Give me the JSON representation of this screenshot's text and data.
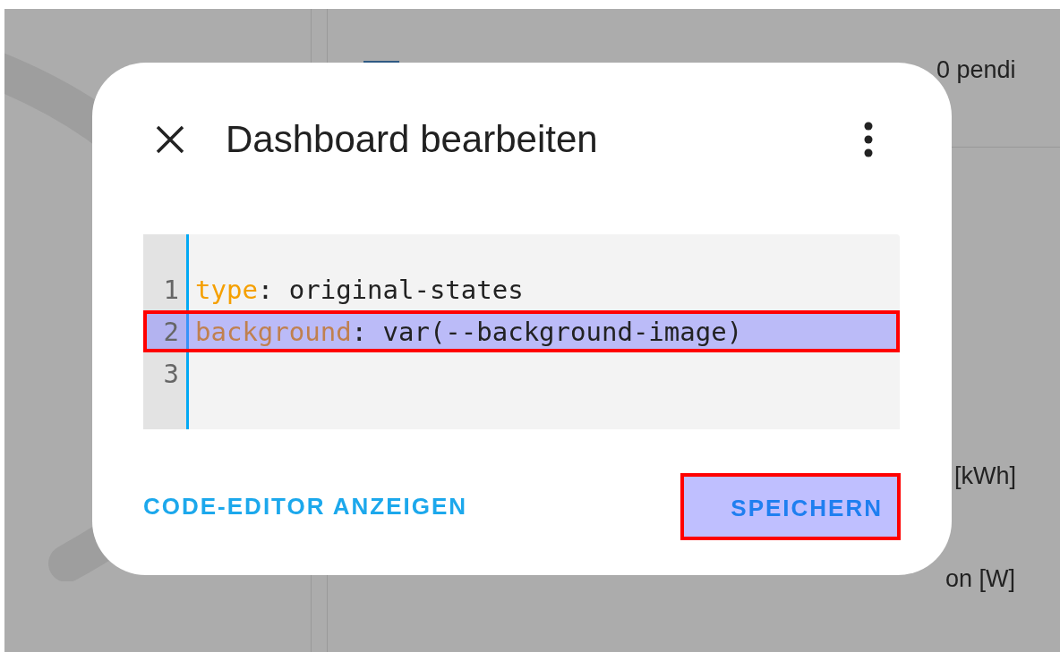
{
  "background": {
    "texts": [
      {
        "text": "0 pendi"
      },
      {
        "text": "[kWh]"
      },
      {
        "text": "on [W]"
      }
    ]
  },
  "dialog": {
    "title": "Dashboard bearbeiten",
    "editor": {
      "lines": [
        {
          "number": "1",
          "key": "type",
          "rest": ": original-states",
          "highlighted": false
        },
        {
          "number": "2",
          "key": "background",
          "rest": ": var(--background-image)",
          "highlighted": true
        },
        {
          "number": "3",
          "highlighted": false
        }
      ]
    },
    "buttons": [
      {
        "label": "CODE-EDITOR ANZEIGEN",
        "highlighted": false
      },
      {
        "label": "SPEICHERN",
        "highlighted": true
      }
    ]
  }
}
